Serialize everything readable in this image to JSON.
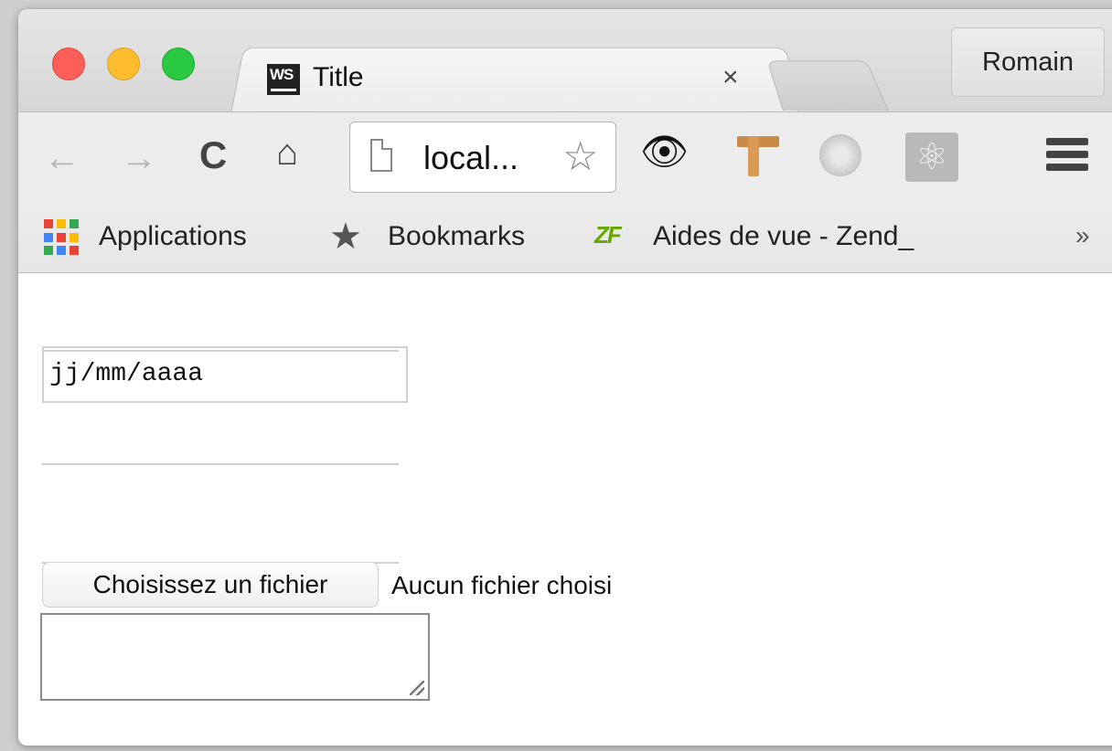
{
  "window": {
    "tab": {
      "favicon_text": "WS",
      "title": "Title",
      "close_glyph": "×"
    },
    "profile_button": "Romain"
  },
  "toolbar": {
    "back_glyph": "←",
    "forward_glyph": "→",
    "reload_glyph": "C",
    "home_glyph": "⌂",
    "url": "local...",
    "star_glyph": "☆",
    "eye_glyph": "👁",
    "react_glyph": "⚛",
    "icons": [
      "back-arrow-icon",
      "forward-arrow-icon",
      "reload-icon",
      "home-icon",
      "page-icon",
      "bookmark-star-icon",
      "eye-extension-icon",
      "ruler-extension-icon",
      "bug-extension-icon",
      "react-extension-icon",
      "menu-icon"
    ]
  },
  "bookmarks": {
    "items": [
      {
        "label": "Applications"
      },
      {
        "label": "Bookmarks"
      },
      {
        "label": "Aides de vue - Zend_"
      }
    ],
    "star_glyph": "★",
    "zf_logo_text": "ZF",
    "overflow_glyph": "»",
    "apps_colors": [
      "#ea4335",
      "#fbbc05",
      "#34a853",
      "#4285f4",
      "#ea4335",
      "#fbbc05",
      "#34a853",
      "#4285f4",
      "#ea4335"
    ]
  },
  "page": {
    "date_input": {
      "placeholder": "jj/mm/aaaa"
    },
    "file_input": {
      "button_label": "Choisissez un fichier",
      "status_text": "Aucun fichier choisi"
    }
  }
}
